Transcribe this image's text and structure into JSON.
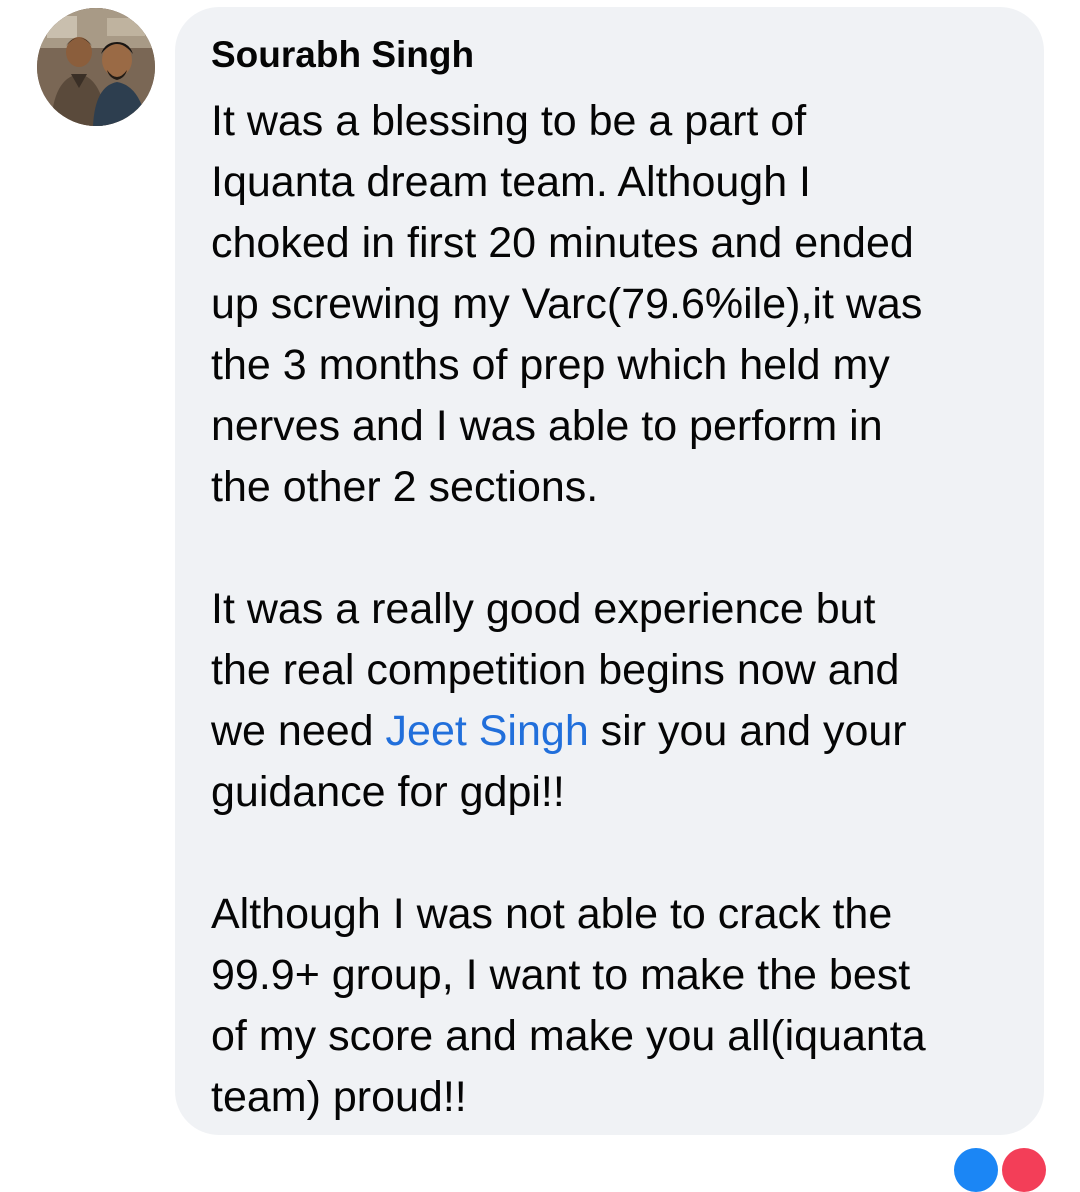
{
  "comment": {
    "author": "Sourabh Singh",
    "avatar_icon": "profile-photo-two-people",
    "paragraphs": [
      {
        "segments": [
          {
            "text": "It was a blessing to be  a part of\nIquanta dream team. Although I\nchoked in first 20 minutes and ended\nup screwing my Varc(79.6%ile),it was\nthe 3 months of prep which held my\nnerves and I was able to perform in\nthe other 2 sections."
          }
        ]
      },
      {
        "segments": [
          {
            "text": "It was a really good experience but\nthe real competition begins now and\nwe need "
          },
          {
            "text": "Jeet Singh",
            "mention": true
          },
          {
            "text": " sir you and your\nguidance for gdpi!!"
          }
        ]
      },
      {
        "segments": [
          {
            "text": "Although I was not able to crack the\n99.9+ group, I want to make the best\nof my score and make you all(iquanta\nteam) proud!!"
          }
        ]
      }
    ],
    "reactions": [
      "like-icon",
      "love-icon"
    ],
    "colors": {
      "bubble": "#f0f2f5",
      "text": "#050505",
      "mention": "#216fdb",
      "like": "#1b86f5",
      "love": "#f33e58"
    }
  }
}
